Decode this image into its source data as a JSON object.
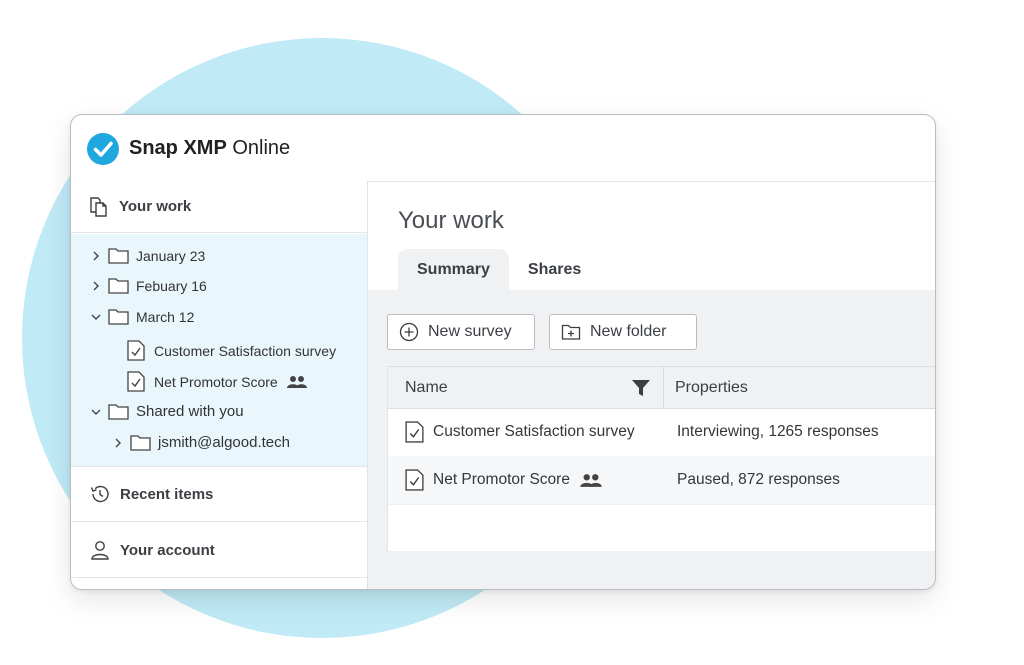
{
  "app": {
    "brand_bold": "Snap XMP",
    "brand_light": "Online"
  },
  "sidebar": {
    "header": "Your work",
    "tree": [
      {
        "label": "January 23",
        "type": "folder",
        "expanded": false
      },
      {
        "label": "Febuary 16",
        "type": "folder",
        "expanded": false
      },
      {
        "label": "March 12",
        "type": "folder",
        "expanded": true
      },
      {
        "label": "Customer Satisfaction survey",
        "type": "survey",
        "shared": false
      },
      {
        "label": "Net Promotor Score",
        "type": "survey",
        "shared": true
      },
      {
        "label": "Shared with you",
        "type": "folder",
        "expanded": true
      },
      {
        "label": "jsmith@algood.tech",
        "type": "folder",
        "expanded": false
      }
    ],
    "nav": [
      {
        "label": "Recent items",
        "icon": "history-icon"
      },
      {
        "label": "Your account",
        "icon": "user-icon"
      }
    ]
  },
  "main": {
    "title": "Your work",
    "tabs": [
      {
        "label": "Summary",
        "active": true
      },
      {
        "label": "Shares",
        "active": false
      }
    ],
    "toolbar": {
      "new_survey": "New survey",
      "new_folder": "New folder"
    },
    "table": {
      "columns": [
        "Name",
        "Properties"
      ],
      "rows": [
        {
          "name": "Customer Satisfaction survey",
          "shared": false,
          "properties": "Interviewing, 1265 responses"
        },
        {
          "name": "Net Promotor Score",
          "shared": true,
          "properties": "Paused, 872 responses"
        }
      ]
    }
  },
  "colors": {
    "accent": "#1fa7e0",
    "highlight": "#e9f7fd",
    "circle": "#bfeaf6"
  }
}
